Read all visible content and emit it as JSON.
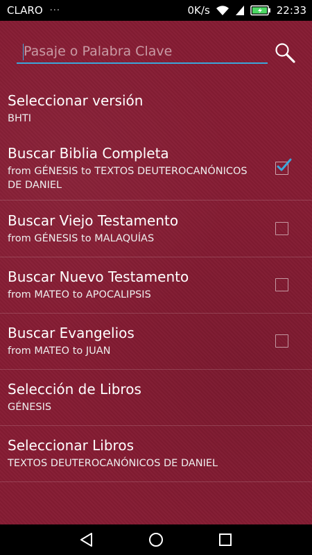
{
  "statusbar": {
    "carrier": "CLARO",
    "notification_dots": "···",
    "data_rate": "0K/s",
    "time": "22:33",
    "icons": [
      "wifi-icon",
      "cell-signal-icon",
      "battery-icon"
    ]
  },
  "search": {
    "placeholder": "Pasaje o Palabra Clave",
    "value": "",
    "button_icon": "search-icon"
  },
  "items": [
    {
      "title": "Seleccionar versión",
      "subtitle": "BHTI",
      "checkbox": null
    },
    {
      "title": "Buscar Biblia Completa",
      "subtitle": "from GÉNESIS to TEXTOS DEUTEROCANÓNICOS DE DANIEL",
      "checkbox": true
    },
    {
      "title": "Buscar Viejo Testamento",
      "subtitle": "from GÉNESIS to MALAQUÍAS",
      "checkbox": false
    },
    {
      "title": "Buscar Nuevo Testamento",
      "subtitle": "from MATEO to APOCALIPSIS",
      "checkbox": false
    },
    {
      "title": "Buscar Evangelios",
      "subtitle": "from MATEO to JUAN",
      "checkbox": false
    },
    {
      "title": "Selección de Libros",
      "subtitle": "GÉNESIS",
      "checkbox": null
    },
    {
      "title": "Seleccionar Libros",
      "subtitle": "TEXTOS DEUTEROCANÓNICOS DE DANIEL",
      "checkbox": null
    }
  ],
  "navbar": {
    "icons": [
      "back-icon",
      "home-icon",
      "recents-icon"
    ]
  },
  "colors": {
    "background": "#861c33",
    "accent": "#3ba7db",
    "battery": "#4cd964"
  }
}
